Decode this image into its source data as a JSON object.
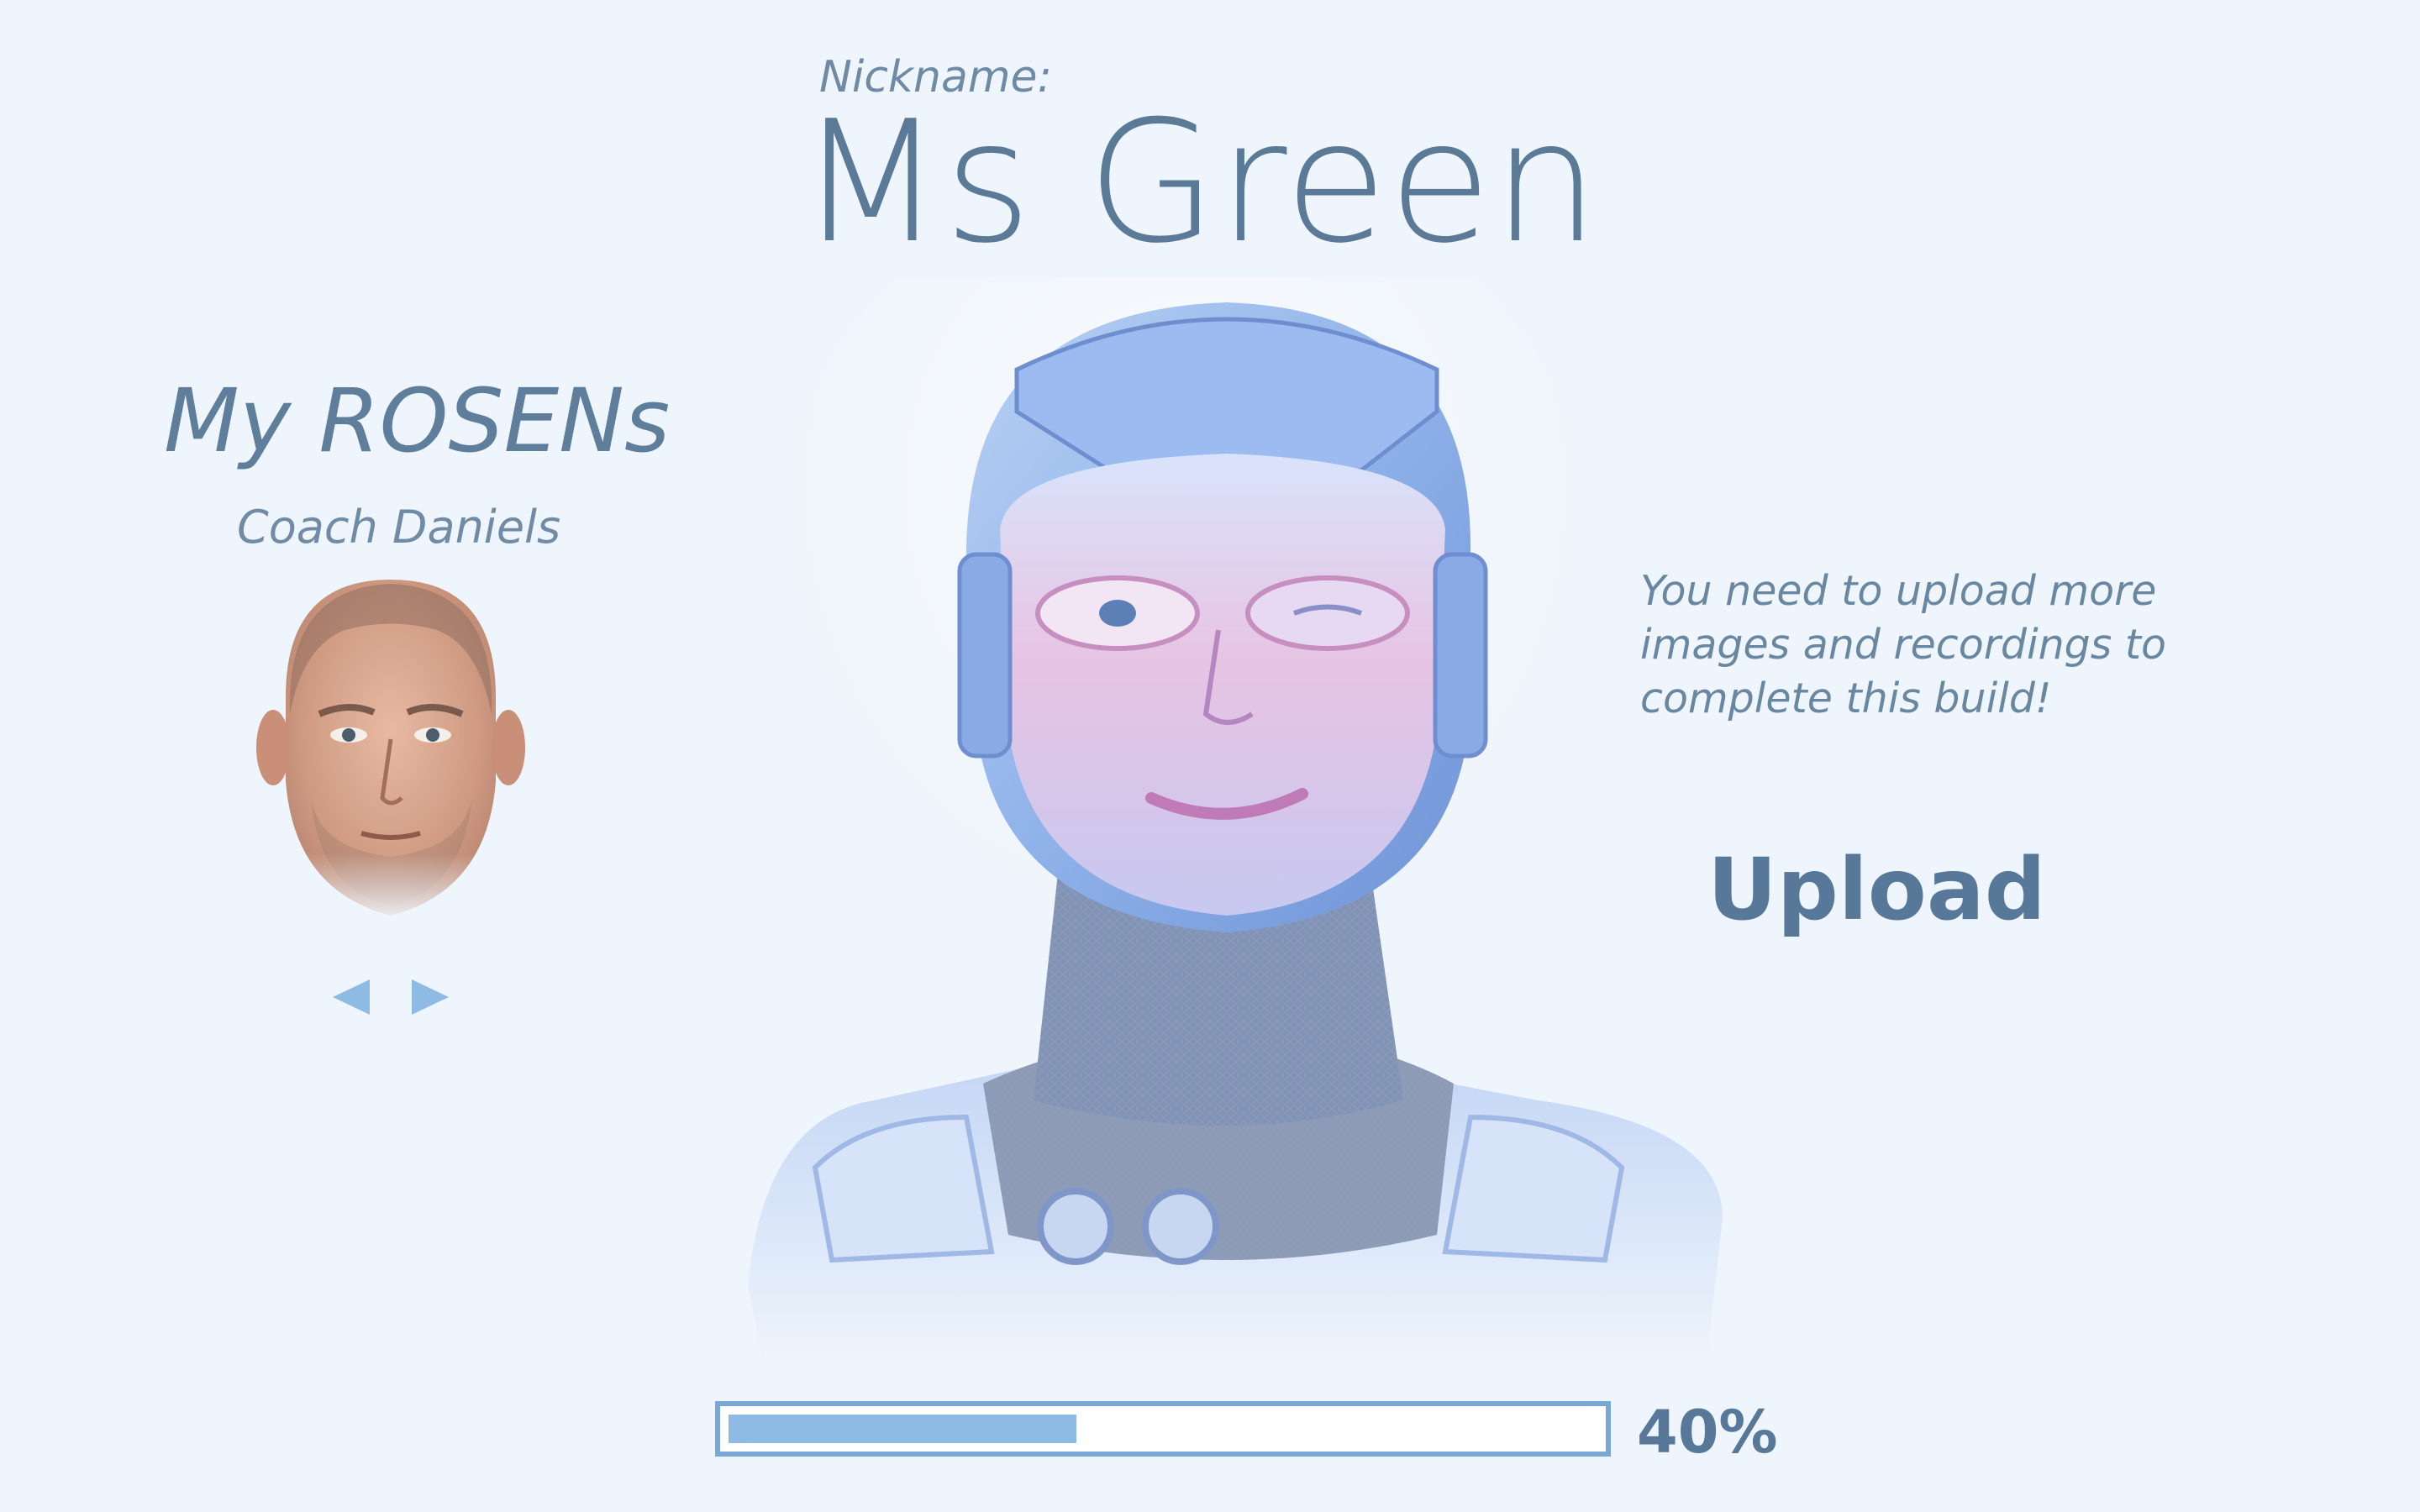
{
  "header": {
    "nickname_label": "Nickname:",
    "nickname_value": "Ms Green"
  },
  "sidebar": {
    "title": "My ROSENs",
    "selected_rosen": "Coach Daniels"
  },
  "build": {
    "message": "You need to upload more images and recordings to complete this build!",
    "upload_label": "Upload"
  },
  "progress": {
    "value": 0.4,
    "label": "40%"
  },
  "colors": {
    "background": "#eff5fc",
    "text": "#5b7a97",
    "accent": "#79a8d5",
    "fill": "#8dbbe4"
  }
}
